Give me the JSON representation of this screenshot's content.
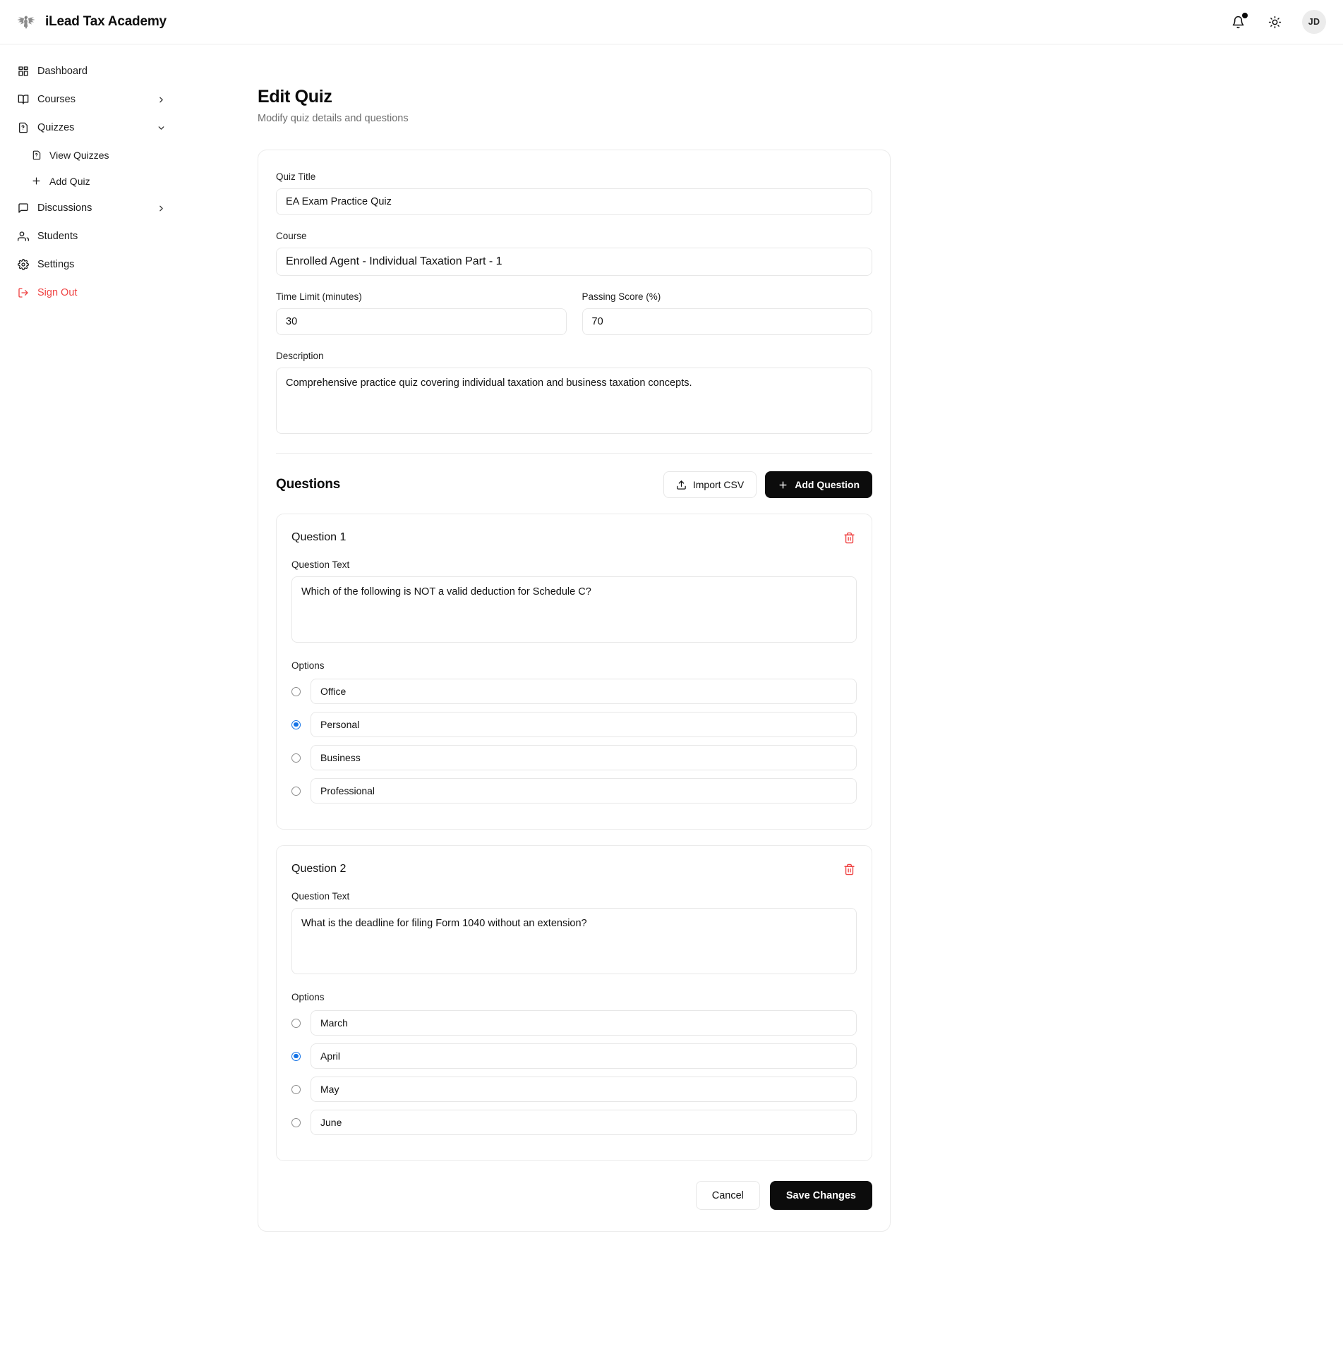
{
  "header": {
    "brand_name": "iLead Tax Academy",
    "logo_icon": "eagle-logo",
    "notifications_icon": "bell-icon",
    "theme_icon": "sun-icon",
    "avatar_initials": "JD"
  },
  "sidebar": {
    "items": [
      {
        "label": "Dashboard",
        "icon": "grid-icon",
        "chevron": "",
        "sub": false
      },
      {
        "label": "Courses",
        "icon": "book-icon",
        "chevron": "chevron-right-icon",
        "sub": false
      },
      {
        "label": "Quizzes",
        "icon": "quiz-file-icon",
        "chevron": "chevron-down-icon",
        "sub": false
      },
      {
        "label": "View Quizzes",
        "icon": "quiz-file-icon",
        "chevron": "",
        "sub": true
      },
      {
        "label": "Add Quiz",
        "icon": "plus-icon",
        "chevron": "",
        "sub": true
      },
      {
        "label": "Discussions",
        "icon": "chat-icon",
        "chevron": "chevron-right-icon",
        "sub": false
      },
      {
        "label": "Students",
        "icon": "users-icon",
        "chevron": "",
        "sub": false
      },
      {
        "label": "Settings",
        "icon": "gear-icon",
        "chevron": "",
        "sub": false
      },
      {
        "label": "Sign Out",
        "icon": "logout-icon",
        "chevron": "",
        "sub": false
      }
    ]
  },
  "page": {
    "title": "Edit Quiz",
    "subtitle": "Modify quiz details and questions"
  },
  "form": {
    "quiz_title_label": "Quiz Title",
    "quiz_title_value": "EA Exam Practice Quiz",
    "course_label": "Course",
    "course_value": "Enrolled Agent - Individual Taxation Part - 1",
    "time_limit_label": "Time Limit (minutes)",
    "time_limit_value": "30",
    "passing_score_label": "Passing Score (%)",
    "passing_score_value": "70",
    "description_label": "Description",
    "description_value": "Comprehensive practice quiz covering individual taxation and business taxation concepts."
  },
  "questions_section": {
    "title": "Questions",
    "import_csv_label": "Import CSV",
    "import_csv_icon": "upload-icon",
    "add_question_label": "Add Question",
    "add_question_icon": "plus-icon",
    "question_text_label": "Question Text",
    "options_label": "Options",
    "delete_icon": "trash-icon",
    "items": [
      {
        "title": "Question 1",
        "text": "Which of the following is NOT a valid deduction for Schedule C?",
        "options": [
          {
            "text": "Office",
            "selected": false
          },
          {
            "text": "Personal",
            "selected": true
          },
          {
            "text": "Business",
            "selected": false
          },
          {
            "text": "Professional",
            "selected": false
          }
        ]
      },
      {
        "title": "Question 2",
        "text": "What is the deadline for filing Form 1040 without an extension?",
        "options": [
          {
            "text": "March",
            "selected": false
          },
          {
            "text": "April",
            "selected": true
          },
          {
            "text": "May",
            "selected": false
          },
          {
            "text": "June",
            "selected": false
          }
        ]
      }
    ]
  },
  "footer": {
    "cancel_label": "Cancel",
    "save_label": "Save Changes"
  },
  "colors": {
    "accent_dark": "#0c0c0c",
    "danger": "#ef4444",
    "radio_selected": "#1473e6",
    "border": "#ebebeb",
    "muted_text": "#6e6e6e"
  }
}
